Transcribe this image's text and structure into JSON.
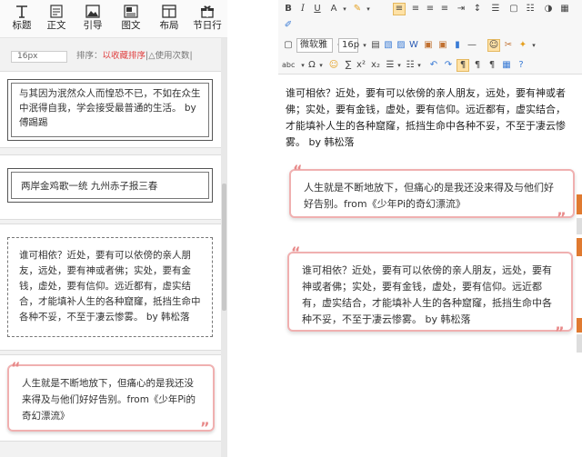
{
  "left_panel": {
    "tabs": [
      {
        "label": "标题",
        "icon": "heading-icon"
      },
      {
        "label": "正文",
        "icon": "text-icon"
      },
      {
        "label": "引导",
        "icon": "image-guide-icon"
      },
      {
        "label": "图文",
        "icon": "image-text-icon"
      },
      {
        "label": "布局",
        "icon": "layout-icon"
      },
      {
        "label": "节日行",
        "icon": "gift-icon"
      }
    ],
    "filter": {
      "input_value": "16px",
      "text_pre": "排序：",
      "text_red": "以收藏排序",
      "text_post": "|△使用次数|"
    },
    "templates": [
      {
        "text": "与其因为泯然众人而惶恐不已，不如在众生中泯得自我，学会接受最普通的生活。 by 傅踢踢"
      },
      {
        "text": "两岸金鸡歌一统  九州赤子报三春"
      },
      {
        "text": "谁可相依？近处，要有可以依傍的亲人朋友，远处，要有神或者佛；实处，要有金钱，虚处，要有信仰。远近都有，虚实结合，才能填补人生的各种窟窿，抵挡生命中各种不妥，不至于凄云惨雾。 by 韩松落"
      },
      {
        "text": "人生就是不断地放下，但痛心的是我还没来得及与他们好好告别。from《少年Pi的奇幻漂流》"
      }
    ]
  },
  "editor": {
    "font_select": "微软雅",
    "size_select": "16p",
    "content_paragraph": "谁可相依？近处，要有可以依傍的亲人朋友，远处，要有神或者佛；实处，要有金钱，虚处，要有信仰。远近都有，虚实结合，才能填补人生的各种窟窿，抵挡生命中各种不妥，不至于凄云惨雾。 by 韩松落",
    "quote_box_1": "人生就是不断地放下，但痛心的是我还没来得及与他们好好告别。from《少年Pi的奇幻漂流》",
    "quote_box_2": "谁可相依？近处，要有可以依傍的亲人朋友，远处，要有神或者佛；实处，要有金钱，虚处，要有信仰。远近都有，虚实结合，才能填补人生的各种窟窿，抵挡生命中各种不妥，不至于凄云惨雾。 by 韩松落"
  },
  "colors": {
    "accent_pink": "#f0b0b0",
    "quote_mark": "#e88a8a",
    "side_mark": "#e07a30",
    "filter_red": "#e04040"
  }
}
